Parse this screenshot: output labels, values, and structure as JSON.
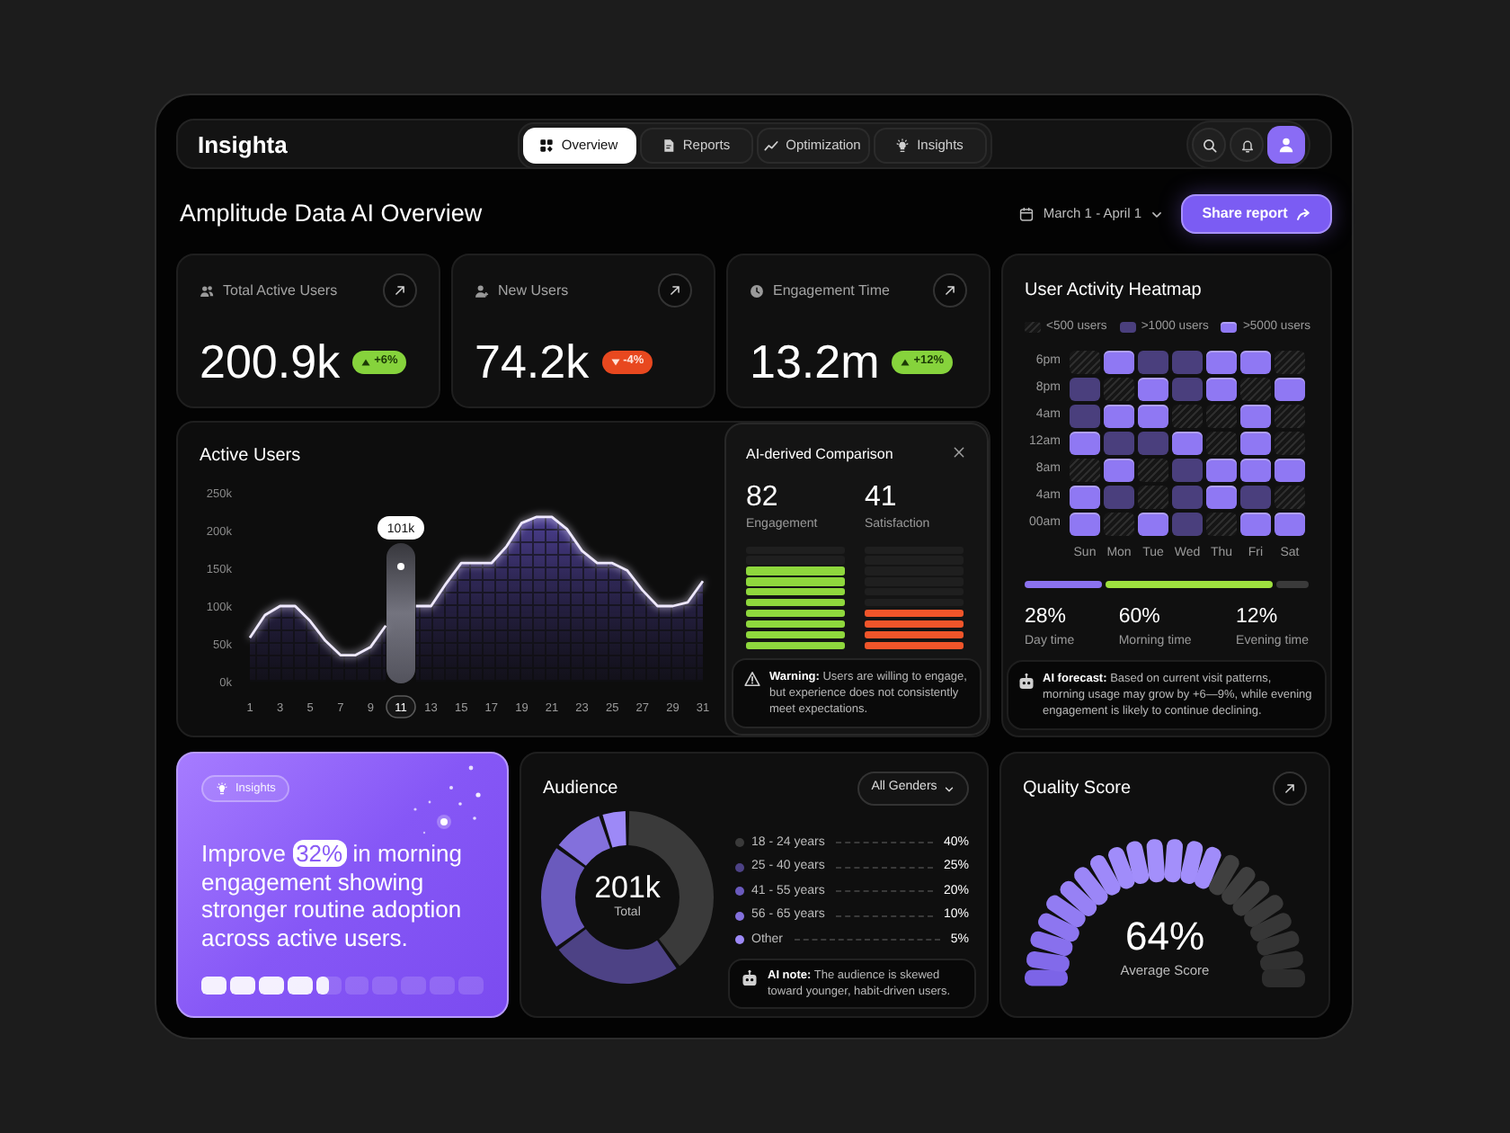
{
  "header": {
    "logo": "Insighta",
    "tabs": [
      {
        "label": "Overview",
        "selected": true
      },
      {
        "label": "Reports",
        "selected": false
      },
      {
        "label": "Optimization",
        "selected": false
      },
      {
        "label": "Insights",
        "selected": false
      }
    ]
  },
  "toolbar": {
    "title": "Amplitude Data AI Overview",
    "date_range": "March 1 - April 1",
    "share_button": "Share report"
  },
  "kpis": [
    {
      "label": "Total Active Users",
      "value": "200.9k",
      "change": "+6%",
      "kind": "up"
    },
    {
      "label": "New Users",
      "value": "74.2k",
      "change": "-4%",
      "kind": "down"
    },
    {
      "label": "Engagement Time",
      "value": "13.2m",
      "change": "+12%",
      "kind": "up"
    }
  ],
  "heatmap": {
    "title": "User Activity Heatmap",
    "legend": [
      {
        "label": "<500 users",
        "kind": "low"
      },
      {
        "label": ">1000 users",
        "kind": "mid"
      },
      {
        "label": ">5000 users",
        "kind": "high"
      }
    ],
    "rows": [
      {
        "label": "6pm",
        "cells": [
          {
            "kind": "low"
          },
          {
            "kind": "high"
          },
          {
            "kind": "mid"
          },
          {
            "kind": "mid"
          },
          {
            "kind": "high"
          },
          {
            "kind": "high"
          },
          {
            "kind": "low"
          }
        ]
      },
      {
        "label": "8pm",
        "cells": [
          {
            "kind": "mid"
          },
          {
            "kind": "low"
          },
          {
            "kind": "high"
          },
          {
            "kind": "mid"
          },
          {
            "kind": "high"
          },
          {
            "kind": "low"
          },
          {
            "kind": "high"
          }
        ]
      },
      {
        "label": "4am",
        "cells": [
          {
            "kind": "mid"
          },
          {
            "kind": "high"
          },
          {
            "kind": "high"
          },
          {
            "kind": "low"
          },
          {
            "kind": "low"
          },
          {
            "kind": "high"
          },
          {
            "kind": "low"
          }
        ]
      },
      {
        "label": "12am",
        "cells": [
          {
            "kind": "high"
          },
          {
            "kind": "mid"
          },
          {
            "kind": "mid"
          },
          {
            "kind": "high"
          },
          {
            "kind": "low"
          },
          {
            "kind": "high"
          },
          {
            "kind": "low"
          }
        ]
      },
      {
        "label": "8am",
        "cells": [
          {
            "kind": "low"
          },
          {
            "kind": "high"
          },
          {
            "kind": "low"
          },
          {
            "kind": "mid"
          },
          {
            "kind": "high"
          },
          {
            "kind": "high"
          },
          {
            "kind": "high"
          }
        ]
      },
      {
        "label": "4am",
        "cells": [
          {
            "kind": "high"
          },
          {
            "kind": "mid"
          },
          {
            "kind": "low"
          },
          {
            "kind": "mid"
          },
          {
            "kind": "high"
          },
          {
            "kind": "mid"
          },
          {
            "kind": "low"
          }
        ]
      },
      {
        "label": "00am",
        "cells": [
          {
            "kind": "high"
          },
          {
            "kind": "low"
          },
          {
            "kind": "high"
          },
          {
            "kind": "mid"
          },
          {
            "kind": "low"
          },
          {
            "kind": "high"
          },
          {
            "kind": "high"
          }
        ]
      }
    ],
    "days": [
      "Sun",
      "Mon",
      "Tue",
      "Wed",
      "Thu",
      "Fri",
      "Sat"
    ],
    "time_split": [
      {
        "value": "28%",
        "label": "Day time",
        "color": "#8b72f0"
      },
      {
        "value": "60%",
        "label": "Morning time",
        "color": "#9ee03f"
      },
      {
        "value": "12%",
        "label": "Evening time",
        "color": "#3a3a3a"
      }
    ],
    "forecast": "**AI forecast:** Based on current visit patterns, morning usage may grow by +6—9%, while evening engagement is likely to continue declining."
  },
  "active_users": {
    "title": "Active Users",
    "chart_data": {
      "type": "area",
      "x": [
        1,
        2,
        3,
        4,
        5,
        6,
        7,
        8,
        9,
        10,
        11,
        12,
        13,
        14,
        15,
        16,
        17,
        18,
        19,
        20,
        21,
        22,
        23,
        24,
        25,
        26,
        27,
        28,
        29,
        30,
        31
      ],
      "values": [
        58,
        88,
        100,
        100,
        80,
        54,
        35,
        35,
        46,
        74,
        null,
        100,
        100,
        130,
        157,
        157,
        157,
        179,
        210,
        218,
        218,
        202,
        173,
        157,
        157,
        147,
        121,
        100,
        100,
        105,
        133
      ],
      "xlim": [
        1,
        31
      ],
      "ylim": [
        0,
        250
      ],
      "yticks": [
        {
          "value": 0,
          "label": "0k"
        },
        {
          "value": 50,
          "label": "50k"
        },
        {
          "value": 100,
          "label": "100k"
        },
        {
          "value": 150,
          "label": "150k"
        },
        {
          "value": 200,
          "label": "200k"
        },
        {
          "value": 250,
          "label": "250k"
        }
      ],
      "xticks": [
        1,
        3,
        5,
        7,
        9,
        11,
        13,
        15,
        17,
        19,
        21,
        23,
        25,
        27,
        29,
        31
      ],
      "annotations": [
        {
          "x": 11,
          "text": "101k"
        }
      ]
    }
  },
  "comparison": {
    "title": "AI-derived Comparison",
    "metrics": [
      {
        "value": "82",
        "label": "Engagement",
        "level": 0.82,
        "color": "#8fd83d"
      },
      {
        "value": "41",
        "label": "Satisfaction",
        "level": 0.41,
        "color": "#f0552a"
      }
    ],
    "warning": "**Warning:** Users are willing to engage, but experience does not consistently meet expectations."
  },
  "insight": {
    "tag": "Insights",
    "text": "Improve **32%** in morning engagement showing stronger routine adoption across active users.",
    "level": 0.45
  },
  "audience": {
    "title": "Audience",
    "filter": "All Genders",
    "total": "201k",
    "total_label": "Total",
    "chart_data": {
      "type": "donut",
      "categories": [
        "18 - 24 years",
        "25 - 40 years",
        "41 - 55 years",
        "56 - 65 years",
        "Other"
      ],
      "values": [
        40,
        25,
        20,
        10,
        5
      ],
      "value_labels": [
        "40%",
        "25%",
        "20%",
        "10%",
        "5%"
      ],
      "colors": [
        "#3a3a3a",
        "#4d4285",
        "#6a5abd",
        "#8370dc",
        "#9d89f7"
      ]
    },
    "note": "**AI note:** The audience is skewed toward younger, habit-driven users."
  },
  "quality": {
    "title": "Quality Score",
    "value": "64%",
    "label": "Average Score",
    "level": 0.64
  }
}
